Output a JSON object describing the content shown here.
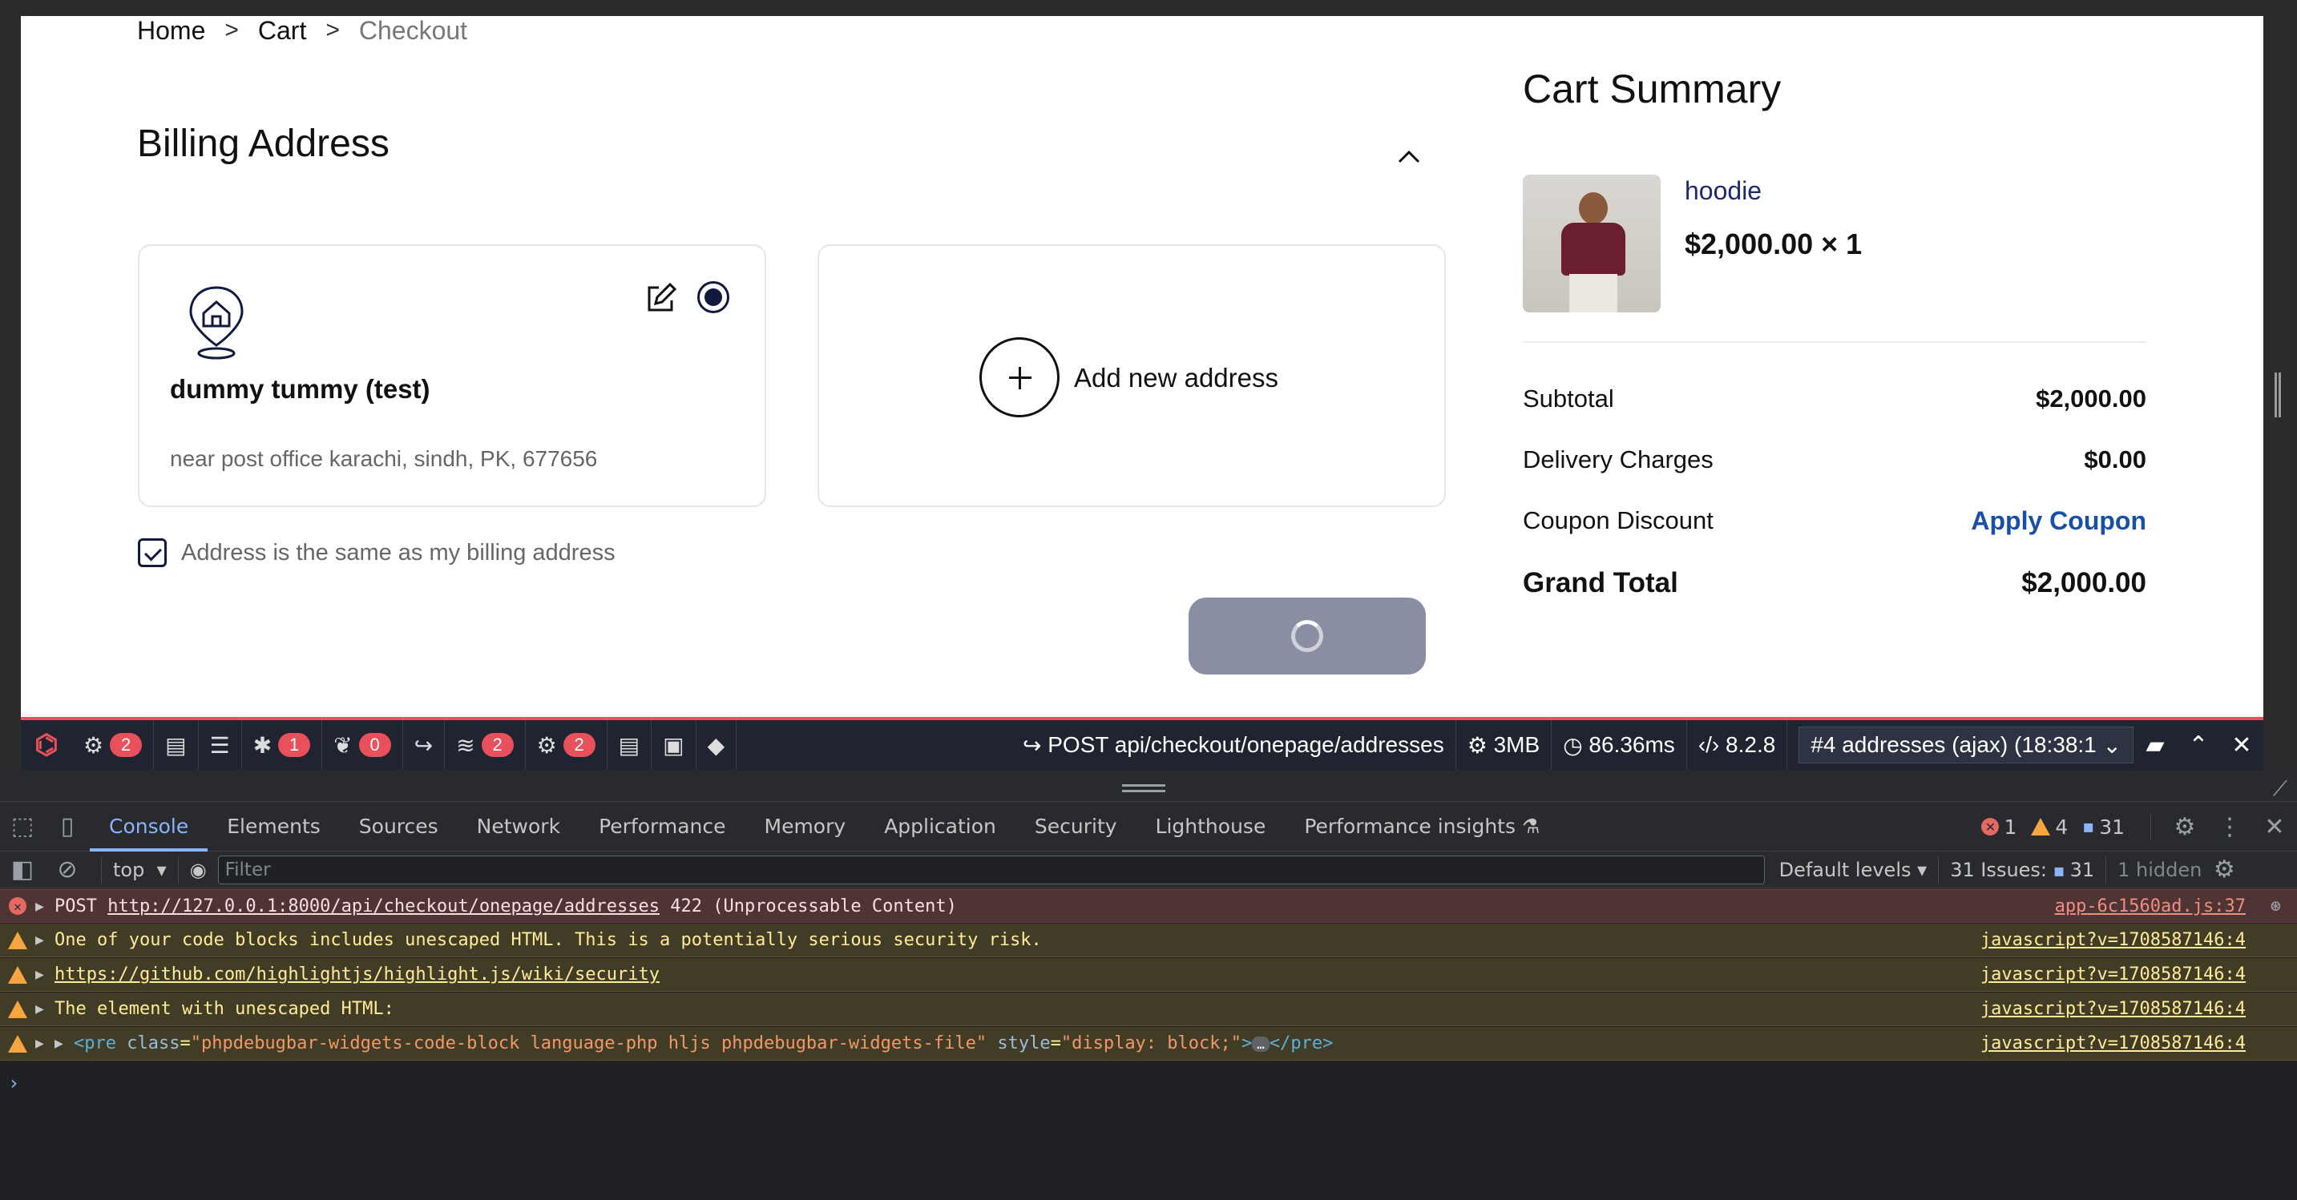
{
  "breadcrumb": {
    "home": "Home",
    "cart": "Cart",
    "current": "Checkout",
    "sep": ">"
  },
  "billing": {
    "title": "Billing Address",
    "address": {
      "name": "dummy tummy (test)",
      "line": "near post office karachi, sindh, PK, 677656"
    },
    "add_new_label": "Add new address",
    "same_address_label": "Address is the same as my billing address"
  },
  "summary": {
    "title": "Cart Summary",
    "product": {
      "name": "hoodie",
      "price_qty": "$2,000.00 × 1"
    },
    "rows": {
      "subtotal_label": "Subtotal",
      "subtotal_value": "$2,000.00",
      "delivery_label": "Delivery Charges",
      "delivery_value": "$0.00",
      "coupon_label": "Coupon Discount",
      "coupon_link": "Apply Coupon",
      "total_label": "Grand Total",
      "total_value": "$2,000.00"
    }
  },
  "debugbar": {
    "badges": [
      "2",
      "1",
      "0",
      "2",
      "2"
    ],
    "request": "POST api/checkout/onepage/addresses",
    "memory": "3MB",
    "time": "86.36ms",
    "php": "8.2.8",
    "selected_request": "#4 addresses (ajax) (18:38:1"
  },
  "devtools": {
    "tabs": [
      "Console",
      "Elements",
      "Sources",
      "Network",
      "Performance",
      "Memory",
      "Application",
      "Security",
      "Lighthouse",
      "Performance insights"
    ],
    "counts": {
      "errors": "1",
      "warnings": "4",
      "messages": "31"
    },
    "context": "top",
    "filter_placeholder": "Filter",
    "levels": "Default levels",
    "issues_label": "31 Issues:",
    "issues_count": "31",
    "hidden": "1 hidden"
  },
  "console": {
    "rows": [
      {
        "type": "error",
        "pre": "POST ",
        "link": "http://127.0.0.1:8000/api/checkout/onepage/addresses",
        "post": " 422 (Unprocessable Content)",
        "source": "app-6c1560ad.js:37"
      },
      {
        "type": "warn",
        "text": "One of your code blocks includes unescaped HTML. This is a potentially serious security risk.",
        "source": "javascript?v=1708587146:4"
      },
      {
        "type": "warn",
        "link": "https://github.com/highlightjs/highlight.js/wiki/security",
        "source": "javascript?v=1708587146:4"
      },
      {
        "type": "warn",
        "text": "The element with unescaped HTML:",
        "source": "javascript?v=1708587146:4"
      },
      {
        "type": "warn",
        "tag_open": "<pre",
        "attr1": "class",
        "val1": "\"phpdebugbar-widgets-code-block language-php hljs phpdebugbar-widgets-file\"",
        "attr2": "style",
        "val2": "\"display: block;\"",
        "tag_close": "</pre>",
        "source": "javascript?v=1708587146:4"
      }
    ]
  },
  "colors": {
    "accent": "#1a4fa8",
    "debug_red": "#e8505b",
    "button_disabled": "#8a8ea3"
  }
}
